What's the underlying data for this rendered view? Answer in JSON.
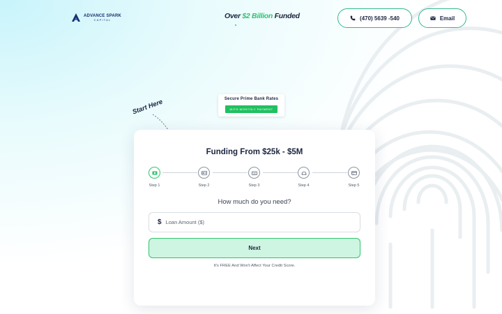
{
  "brand": {
    "name": "ADVANCE SPARK",
    "sub": "CAPITAL"
  },
  "header": {
    "tagline_prefix": "Over ",
    "tagline_accent": "$2 Billion",
    "tagline_suffix": " Funded",
    "phone_label": "(470) 5639 -540",
    "email_label": "Email"
  },
  "annotation": {
    "start_here": "Start Here"
  },
  "badge": {
    "title": "Secure Prime Bank Rates",
    "subtitle": "WITH MONTHLY PAYMENT"
  },
  "form": {
    "title": "Funding From $25k - $5M",
    "steps": [
      {
        "label": "Step 1",
        "icon": "cash-icon",
        "active": true
      },
      {
        "label": "Step 2",
        "icon": "id-card-icon",
        "active": false
      },
      {
        "label": "Step 3",
        "icon": "keyboard-icon",
        "active": false
      },
      {
        "label": "Step 4",
        "icon": "car-icon",
        "active": false
      },
      {
        "label": "Step 5",
        "icon": "credit-card-icon",
        "active": false
      }
    ],
    "question": "How much do you need?",
    "currency_symbol": "$",
    "amount_placeholder": "Loan Amount ($)",
    "amount_value": "",
    "next_label": "Next",
    "disclaimer": "It's FREE And Won't Affect Your Credit Score."
  },
  "colors": {
    "accent_green": "#2fc46f",
    "navy": "#1b2540",
    "button_fill": "#cdf5e1"
  }
}
